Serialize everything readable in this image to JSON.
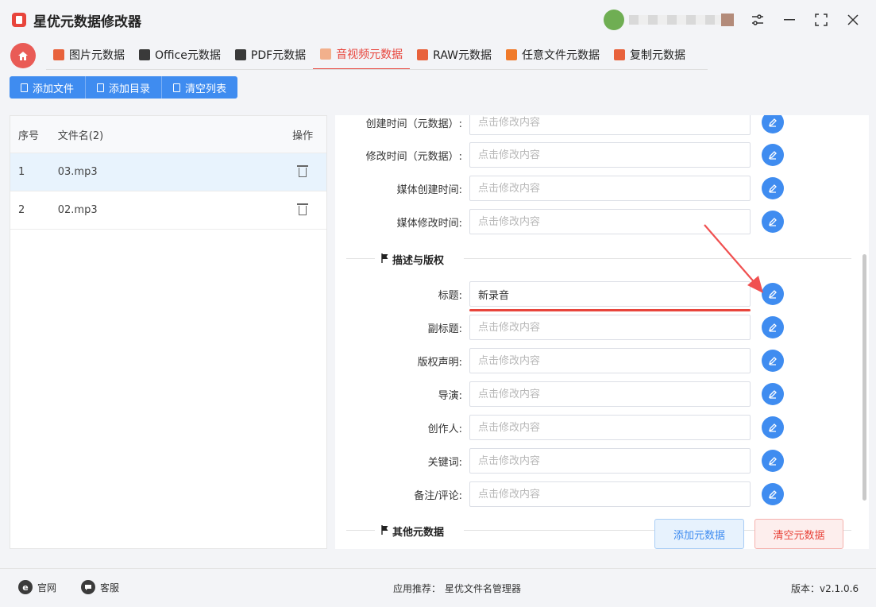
{
  "app": {
    "title": "星优元数据修改器"
  },
  "tabs": [
    {
      "label": "图片元数据",
      "color": "#e8623c"
    },
    {
      "label": "Office元数据",
      "color": "#333333"
    },
    {
      "label": "PDF元数据",
      "color": "#333333"
    },
    {
      "label": "音视频元数据",
      "color": "#e8453c"
    },
    {
      "label": "RAW元数据",
      "color": "#e8623c"
    },
    {
      "label": "任意文件元数据",
      "color": "#f07a2a"
    },
    {
      "label": "复制元数据",
      "color": "#e8623c"
    }
  ],
  "toolbar": {
    "add_file": "添加文件",
    "add_dir": "添加目录",
    "clear_list": "清空列表"
  },
  "filelist": {
    "headers": {
      "no": "序号",
      "name": "文件名(2)",
      "op": "操作"
    },
    "rows": [
      {
        "no": "1",
        "name": "03.mp3"
      },
      {
        "no": "2",
        "name": "02.mp3"
      }
    ]
  },
  "form": {
    "placeholder": "点击修改内容",
    "fields": [
      {
        "label": "创建时间（元数据）:",
        "value": ""
      },
      {
        "label": "修改时间（元数据）:",
        "value": ""
      },
      {
        "label": "媒体创建时间:",
        "value": ""
      },
      {
        "label": "媒体修改时间:",
        "value": ""
      },
      {
        "label": "标题:",
        "value": "新录音"
      },
      {
        "label": "副标题:",
        "value": ""
      },
      {
        "label": "版权声明:",
        "value": ""
      },
      {
        "label": "导演:",
        "value": ""
      },
      {
        "label": "创作人:",
        "value": ""
      },
      {
        "label": "关键词:",
        "value": ""
      },
      {
        "label": "备注/评论:",
        "value": ""
      }
    ],
    "sections": {
      "desc": "描述与版权",
      "other": "其他元数据"
    }
  },
  "actions": {
    "add_meta": "添加元数据",
    "clear_meta": "清空元数据"
  },
  "footer": {
    "website": "官网",
    "support": "客服",
    "recommend_label": "应用推荐：",
    "recommend_app": "星优文件名管理器",
    "version": "版本：v2.1.0.6"
  }
}
